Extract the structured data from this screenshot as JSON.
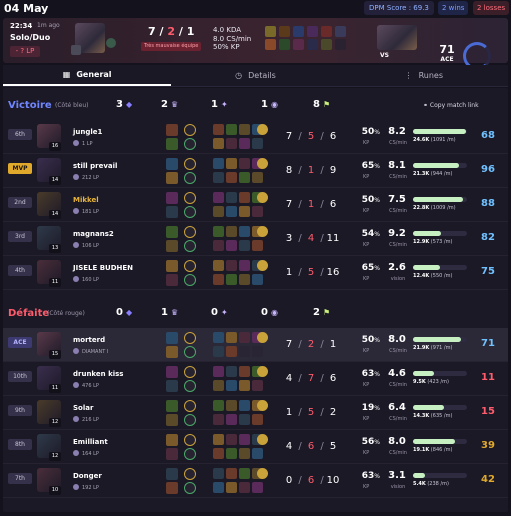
{
  "page": {
    "date": "04 May",
    "dpm_score": "DPM Score : 69.3",
    "wins": "2 wins",
    "losses": "2 losses"
  },
  "header": {
    "time": "22:34",
    "ago": "1m ago",
    "mode": "Solo/Duo",
    "lp": "- ? LP",
    "kda": {
      "k": "7",
      "d": "2",
      "a": "1"
    },
    "badge": "Très mauvaise équipe",
    "stats": {
      "kda": "4.0 KDA",
      "cs": "8.0 CS/min",
      "kp": "50% KP"
    },
    "vs": "VS",
    "ace_value": "71",
    "ace_label": "ACE"
  },
  "tabs": [
    {
      "label": "General",
      "icon": "grid-icon"
    },
    {
      "label": "Details",
      "icon": "clock-icon"
    },
    {
      "label": "Runes",
      "icon": "dots-icon"
    }
  ],
  "copy_link": "Copy match link",
  "teams": [
    {
      "result": "Victoire",
      "side": "(Côté bleu)",
      "color": "#6f86ff",
      "objectives": [
        {
          "v": "3",
          "icon": "baron-icon"
        },
        {
          "v": "2",
          "icon": "dragon-icon"
        },
        {
          "v": "1",
          "icon": "herald-icon"
        },
        {
          "v": "1",
          "icon": "voidgrub-icon"
        },
        {
          "v": "8",
          "icon": "tower-icon"
        }
      ],
      "players": [
        {
          "place": "6th",
          "name": "jungle1",
          "rank": "1 LP",
          "level": "16",
          "k": "7",
          "d": "5",
          "a": "6",
          "kp": "50",
          "kp_label": "KP",
          "cs": "8.2",
          "cs_label": "CS/min",
          "dmg": "24.6K",
          "dmg_min": "(1091 /m)",
          "dmg_frac": 0.98,
          "score": "68",
          "score_color": "#6fc1ff"
        },
        {
          "place": "MVP",
          "name": "still prevail",
          "rank": "212 LP",
          "level": "14",
          "k": "8",
          "d": "1",
          "a": "9",
          "kp": "65",
          "kp_label": "KP",
          "cs": "8.1",
          "cs_label": "CS/min",
          "dmg": "21.3K",
          "dmg_min": "(944 /m)",
          "dmg_frac": 0.86,
          "score": "96",
          "score_color": "#6fc1ff"
        },
        {
          "place": "2nd",
          "name": "Mikkel",
          "rank": "181 LP",
          "level": "14",
          "k": "7",
          "d": "1",
          "a": "6",
          "kp": "50",
          "kp_label": "KP",
          "cs": "7.5",
          "cs_label": "CS/min",
          "dmg": "22.8K",
          "dmg_min": "(1009 /m)",
          "dmg_frac": 0.92,
          "score": "88",
          "score_color": "#6fc1ff"
        },
        {
          "place": "3rd",
          "name": "magnans2",
          "rank": "106 LP",
          "level": "13",
          "k": "3",
          "d": "4",
          "a": "11",
          "kp": "54",
          "kp_label": "KP",
          "cs": "9.2",
          "cs_label": "CS/min",
          "dmg": "12.9K",
          "dmg_min": "(573 /m)",
          "dmg_frac": 0.52,
          "score": "82",
          "score_color": "#6fc1ff"
        },
        {
          "place": "4th",
          "name": "JISELE BUDHEN",
          "rank": "160 LP",
          "level": "11",
          "k": "1",
          "d": "5",
          "a": "16",
          "kp": "65",
          "kp_label": "KP",
          "cs": "2.6",
          "cs_label": "vision",
          "dmg": "12.4K",
          "dmg_min": "(550 /m)",
          "dmg_frac": 0.5,
          "score": "75",
          "score_color": "#6fc1ff"
        }
      ]
    },
    {
      "result": "Défaite",
      "side": "(Côté rouge)",
      "color": "#ff5c6c",
      "objectives": [
        {
          "v": "0",
          "icon": "baron-icon"
        },
        {
          "v": "1",
          "icon": "dragon-icon"
        },
        {
          "v": "0",
          "icon": "herald-icon"
        },
        {
          "v": "0",
          "icon": "voidgrub-icon"
        },
        {
          "v": "2",
          "icon": "tower-icon"
        }
      ],
      "players": [
        {
          "place": "ACE",
          "name": "morterd",
          "rank": "DIAMANT I",
          "level": "15",
          "k": "7",
          "d": "2",
          "a": "1",
          "kp": "50",
          "kp_label": "KP",
          "cs": "8.0",
          "cs_label": "CS/min",
          "dmg": "21.9K",
          "dmg_min": "(971 /m)",
          "dmg_frac": 0.89,
          "score": "71",
          "score_color": "#6fc1ff"
        },
        {
          "place": "10th",
          "name": "drunken kiss",
          "rank": "476 LP",
          "level": "11",
          "k": "4",
          "d": "7",
          "a": "6",
          "kp": "63",
          "kp_label": "KP",
          "cs": "4.6",
          "cs_label": "CS/min",
          "dmg": "9.5K",
          "dmg_min": "(423 /m)",
          "dmg_frac": 0.38,
          "score": "11",
          "score_color": "#ff5c6c"
        },
        {
          "place": "9th",
          "name": "Solar",
          "rank": "216 LP",
          "level": "12",
          "k": "1",
          "d": "5",
          "a": "2",
          "kp": "19",
          "kp_label": "KP",
          "cs": "6.4",
          "cs_label": "CS/min",
          "dmg": "14.3K",
          "dmg_min": "(635 /m)",
          "dmg_frac": 0.58,
          "score": "15",
          "score_color": "#ff5c6c"
        },
        {
          "place": "8th",
          "name": "Emilliant",
          "rank": "164 LP",
          "level": "12",
          "k": "4",
          "d": "6",
          "a": "5",
          "kp": "56",
          "kp_label": "KP",
          "cs": "8.0",
          "cs_label": "CS/min",
          "dmg": "19.1K",
          "dmg_min": "(846 /m)",
          "dmg_frac": 0.78,
          "score": "39",
          "score_color": "#e0a92c"
        },
        {
          "place": "7th",
          "name": "Donger",
          "rank": "192 LP",
          "level": "10",
          "k": "0",
          "d": "6",
          "a": "10",
          "kp": "63",
          "kp_label": "KP",
          "cs": "3.1",
          "cs_label": "vision",
          "dmg": "5.4K",
          "dmg_min": "(238 /m)",
          "dmg_frac": 0.22,
          "score": "42",
          "score_color": "#e0a92c"
        }
      ]
    }
  ]
}
